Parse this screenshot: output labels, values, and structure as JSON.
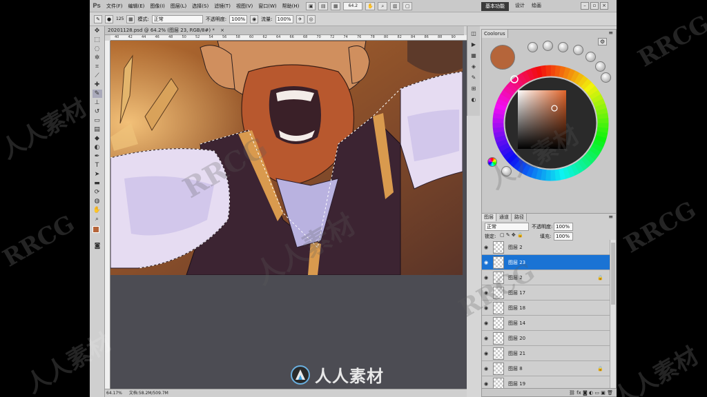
{
  "menu": {
    "logo": "Ps",
    "items": [
      "文件(F)",
      "编辑(E)",
      "图像(I)",
      "图层(L)",
      "选择(S)",
      "滤镜(T)",
      "视图(V)",
      "窗口(W)",
      "帮助(H)"
    ],
    "zoom": "64.2"
  },
  "workspace": {
    "active": "基本功能",
    "links": [
      "设计",
      "绘画"
    ]
  },
  "options": {
    "brush_size": "125",
    "mode_label": "模式:",
    "mode_value": "正常",
    "opacity_label": "不透明度:",
    "opacity_value": "100%",
    "flow_label": "流量:",
    "flow_value": "100%"
  },
  "document": {
    "tab_title": "20201128.psd @ 64.2% (图层 23, RGB/8#) *",
    "status_zoom": "64.17%",
    "status_doc": "文档:58.2M/509.7M",
    "ruler_ticks": [
      "40",
      "42",
      "44",
      "46",
      "48",
      "50",
      "52",
      "54",
      "56",
      "58",
      "60",
      "62",
      "64",
      "66",
      "68",
      "70",
      "72",
      "74",
      "76",
      "78",
      "80",
      "82",
      "84",
      "86",
      "88",
      "90"
    ]
  },
  "coolorus": {
    "title": "Coolorus",
    "current_color": "#b5653a"
  },
  "layers": {
    "tabs": [
      "图层",
      "通道",
      "路径"
    ],
    "blend_mode": "正常",
    "opacity_label": "不透明度:",
    "opacity_value": "100%",
    "lock_label": "锁定:",
    "fill_label": "填充:",
    "fill_value": "100%",
    "rows": [
      {
        "name": "图层 2",
        "selected": false,
        "locked": false
      },
      {
        "name": "图层 23",
        "selected": true,
        "locked": false
      },
      {
        "name": "图层 2",
        "selected": false,
        "locked": true
      },
      {
        "name": "图层 17",
        "selected": false,
        "locked": false
      },
      {
        "name": "图层 18",
        "selected": false,
        "locked": false
      },
      {
        "name": "图层 14",
        "selected": false,
        "locked": false
      },
      {
        "name": "图层 20",
        "selected": false,
        "locked": false
      },
      {
        "name": "图层 21",
        "selected": false,
        "locked": false
      },
      {
        "name": "图层 8",
        "selected": false,
        "locked": true
      },
      {
        "name": "图层 19",
        "selected": false,
        "locked": false
      }
    ]
  },
  "watermark": {
    "text_cn": "人人素材",
    "text_en": "RRCG"
  }
}
